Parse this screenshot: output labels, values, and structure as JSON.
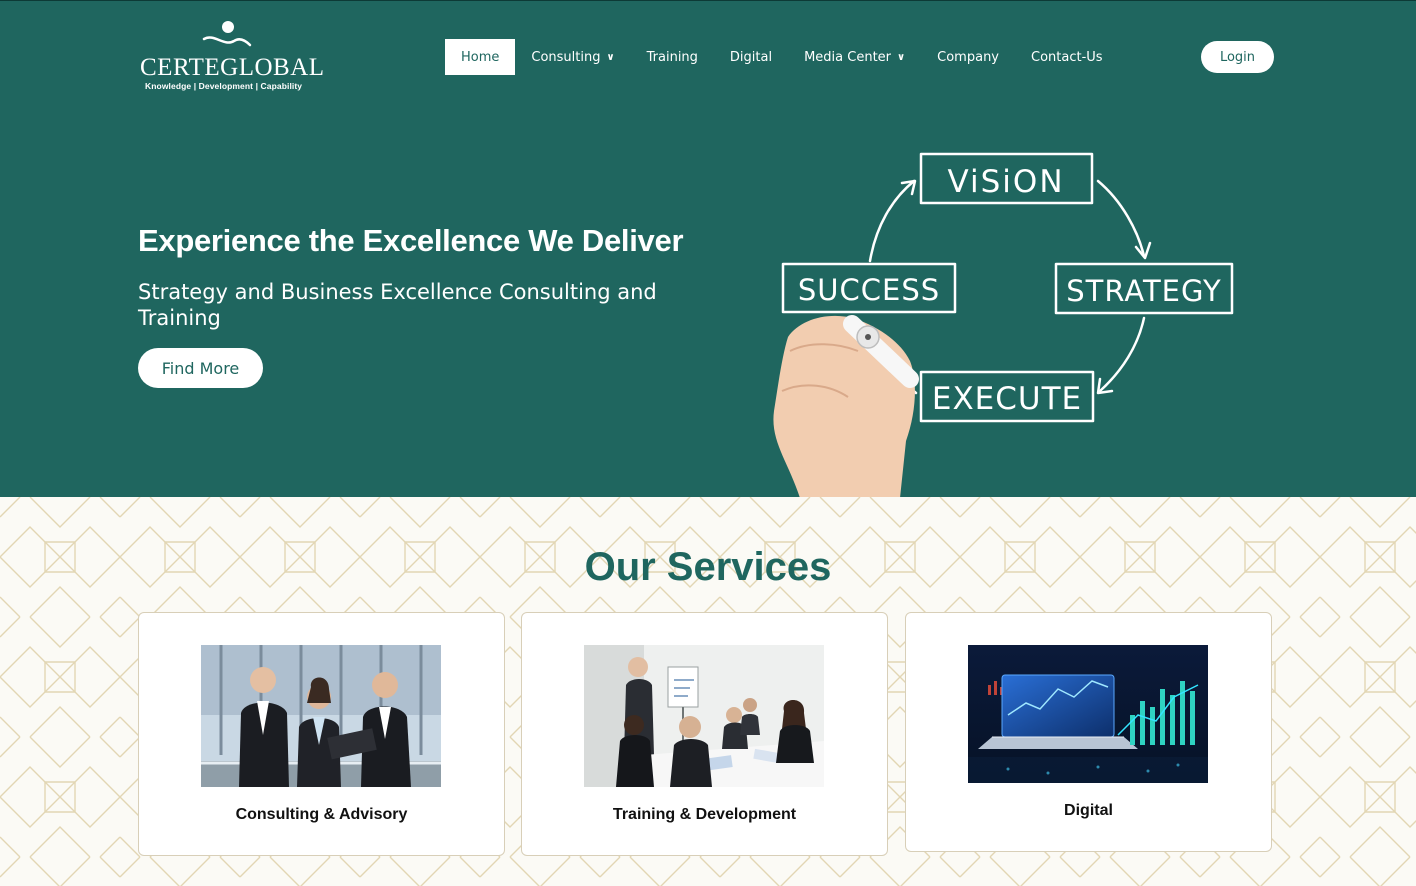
{
  "header": {
    "logo": {
      "brand": "CERTEGLOBAL",
      "tagline": "Knowledge | Development | Capability"
    },
    "nav": [
      {
        "label": "Home",
        "active": true,
        "dropdown": false
      },
      {
        "label": "Consulting",
        "active": false,
        "dropdown": true
      },
      {
        "label": "Training",
        "active": false,
        "dropdown": false
      },
      {
        "label": "Digital",
        "active": false,
        "dropdown": false
      },
      {
        "label": "Media Center",
        "active": false,
        "dropdown": true
      },
      {
        "label": "Company",
        "active": false,
        "dropdown": false
      },
      {
        "label": "Contact-Us",
        "active": false,
        "dropdown": false
      }
    ],
    "login_label": "Login"
  },
  "hero": {
    "title": "Experience the Excellence We Deliver",
    "subtitle": "Strategy and Business Excellence Consulting and Training",
    "cta_label": "Find More",
    "diagram_words": {
      "vision": "ViSiON",
      "strategy": "STRATEGY",
      "execute": "EXECUTE",
      "success": "SUCCESS"
    }
  },
  "services": {
    "title": "Our Services",
    "cards": [
      {
        "label": "Consulting & Advisory",
        "image": "business-team-photo"
      },
      {
        "label": "Training & Development",
        "image": "meeting-room-photo"
      },
      {
        "label": "Digital",
        "image": "digital-laptop-chart-photo"
      }
    ]
  },
  "colors": {
    "brand_teal": "#1f665f",
    "background_cream": "#fbfaf5",
    "pattern_gold": "#e2d6b3"
  }
}
